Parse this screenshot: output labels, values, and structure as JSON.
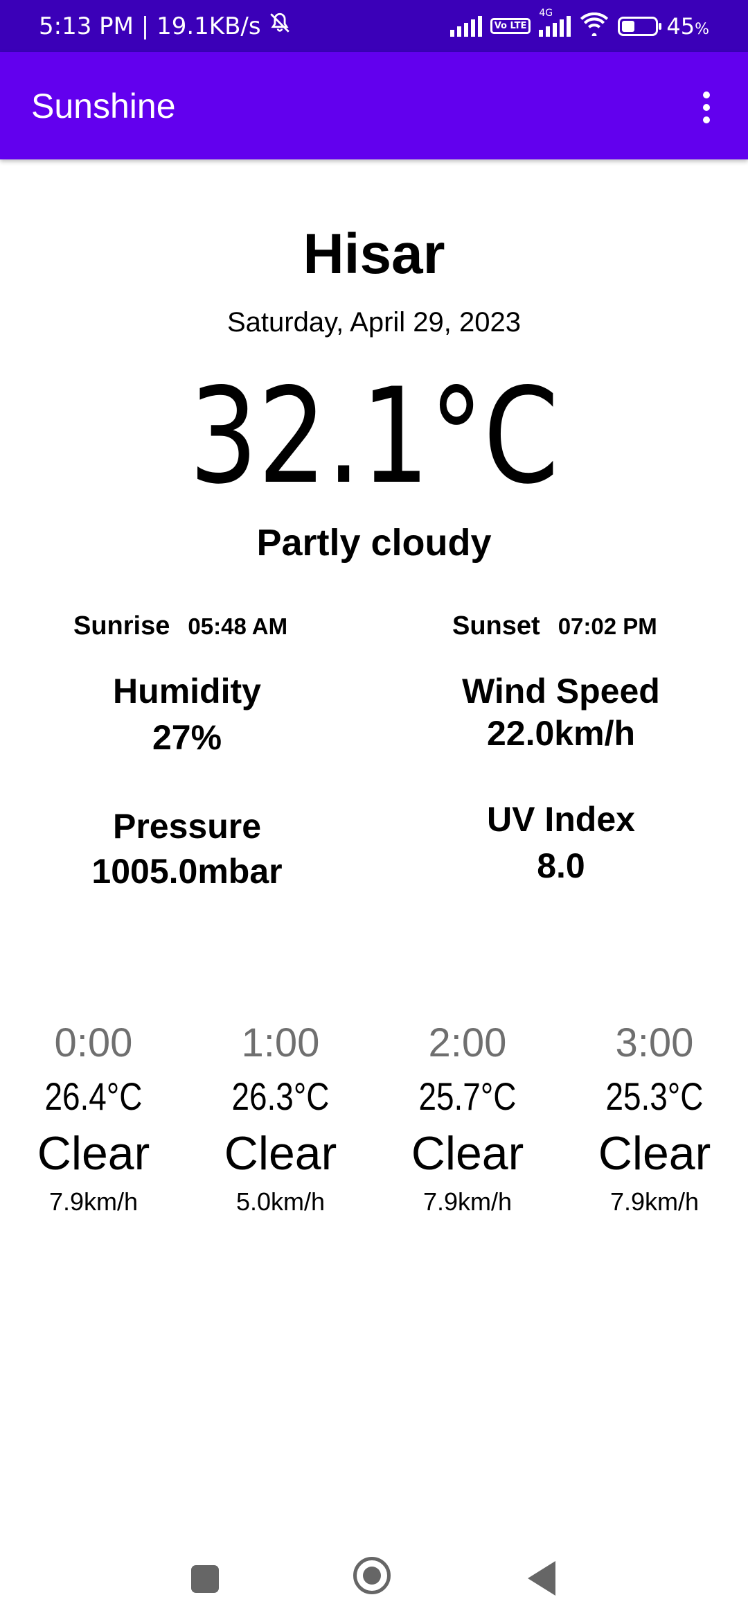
{
  "status_bar": {
    "time_speed": "5:13 PM | 19.1KB/s",
    "volte": "Vo LTE",
    "network": "4G",
    "battery": "45",
    "battery_unit": "%"
  },
  "app_bar": {
    "title": "Sunshine"
  },
  "weather": {
    "city": "Hisar",
    "date": "Saturday, April 29, 2023",
    "temperature": "32.1°C",
    "condition": "Partly cloudy",
    "sunrise_label": "Sunrise",
    "sunrise_time": "05:48 AM",
    "sunset_label": "Sunset",
    "sunset_time": "07:02 PM",
    "humidity_label": "Humidity",
    "humidity_value": "27%",
    "wind_label": "Wind Speed",
    "wind_value": "22.0km/h",
    "pressure_label": "Pressure",
    "pressure_value": "1005.0mbar",
    "uv_label": "UV Index",
    "uv_value": "8.0"
  },
  "hourly": [
    {
      "hour": "0:00",
      "temp": "26.4°C",
      "condition": "Clear",
      "wind": "7.9km/h"
    },
    {
      "hour": "1:00",
      "temp": "26.3°C",
      "condition": "Clear",
      "wind": "5.0km/h"
    },
    {
      "hour": "2:00",
      "temp": "25.7°C",
      "condition": "Clear",
      "wind": "7.9km/h"
    },
    {
      "hour": "3:00",
      "temp": "25.3°C",
      "condition": "Clear",
      "wind": "7.9km/h"
    }
  ],
  "battery_level": 0.45,
  "icons": [
    "bell-off-icon",
    "signal-icon",
    "volte-icon",
    "wifi-icon",
    "battery-icon",
    "overflow-menu-icon",
    "recents-icon",
    "home-icon",
    "back-icon"
  ],
  "colors": {
    "status_bar": "#3b00b8",
    "app_bar": "#6200ee",
    "hour_text": "#6f6f6f"
  }
}
